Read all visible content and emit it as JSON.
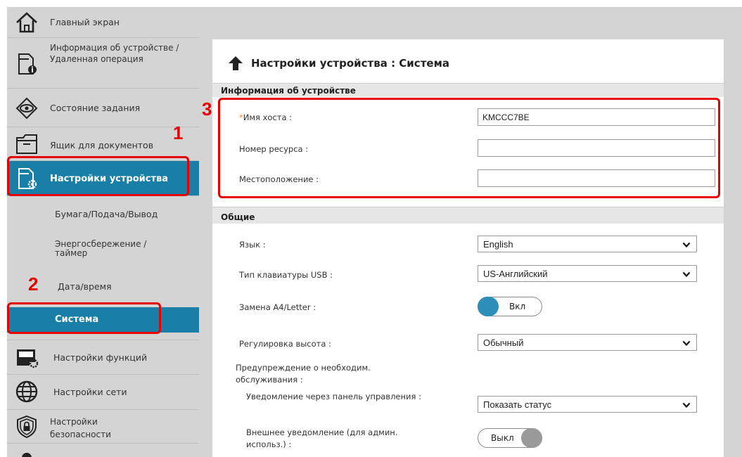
{
  "sidebar": {
    "items": [
      {
        "label": "Главный экран",
        "icon": "home-icon"
      },
      {
        "label": "Информация об устройстве / Удаленная операция",
        "icon": "device-info-icon"
      },
      {
        "label": "Состояние задания",
        "icon": "eye-icon"
      },
      {
        "label": "Ящик для документов",
        "icon": "document-box-icon"
      },
      {
        "label": "Настройки устройства",
        "icon": "device-settings-icon"
      },
      {
        "label": "Настройки функций",
        "icon": "function-settings-icon"
      },
      {
        "label": "Настройки сети",
        "icon": "globe-icon"
      },
      {
        "label": "Настройки безопасности",
        "icon": "shield-lock-icon"
      }
    ],
    "subitems": [
      {
        "label": "Бумага/Подача/Вывод"
      },
      {
        "label": "Энергосбережение / таймер"
      },
      {
        "label": "Дата/время"
      },
      {
        "label": "Система"
      }
    ]
  },
  "page": {
    "title": "Настройки устройства : Система"
  },
  "device_info": {
    "header": "Информация об устройстве",
    "hostname_required_mark": "*",
    "hostname_label": "Имя хоста :",
    "hostname_value": "KMCCC7BE",
    "asset_label": "Номер ресурса :",
    "asset_value": "",
    "location_label": "Местоположение :",
    "location_value": ""
  },
  "general": {
    "header": "Общие",
    "language_label": "Язык :",
    "language_value": "English",
    "usb_kb_label": "Тип клавиатуры USB :",
    "usb_kb_value": "US-Английский",
    "a4_letter_label": "Замена A4/Letter :",
    "a4_letter_value": "Вкл",
    "altitude_label": "Регулировка высота :",
    "altitude_value": "Обычный",
    "maintenance_label": "Предупреждение о необходим. обслуживания :",
    "panel_notify_label": "Уведомление через панель управления :",
    "panel_notify_value": "Показать статус",
    "external_notify_label": "Внешнее уведомление (для админ. использ.) :",
    "external_notify_value": "Выкл"
  },
  "annotations": {
    "step1": "1",
    "step2": "2",
    "step3": "3",
    "color": "#e60000"
  },
  "colors": {
    "accent": "#1a7fa6",
    "sidebar_bg": "#d4d4d4",
    "toggle_on": "#2b8fb8"
  }
}
